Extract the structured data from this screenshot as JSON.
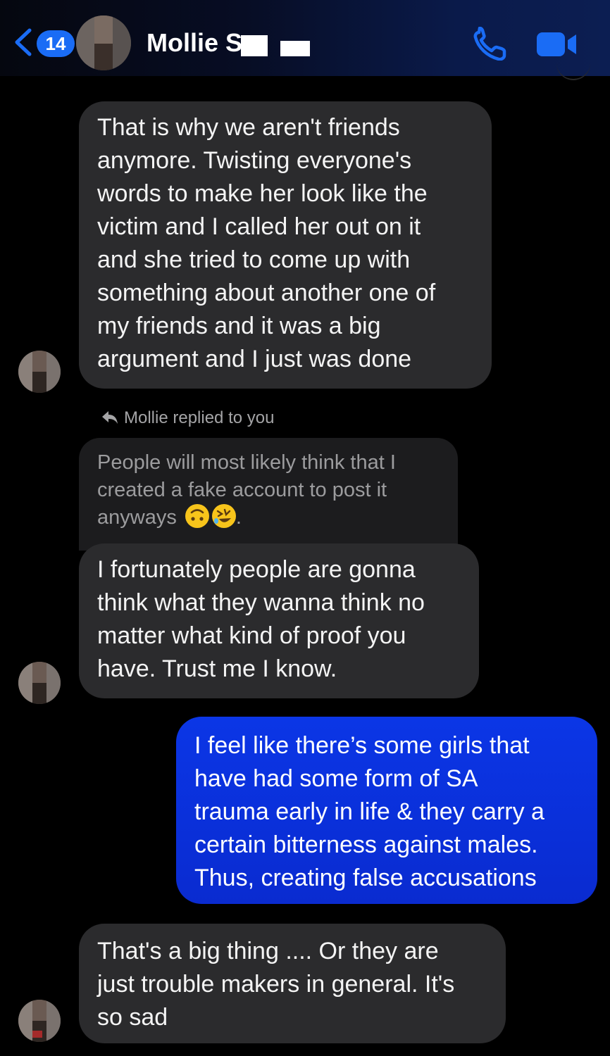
{
  "header": {
    "back_count": "14",
    "contact_name": "Mollie S",
    "icons": {
      "back": "chevron-left-icon",
      "call": "phone-icon",
      "video": "video-camera-icon"
    },
    "accent_color": "#1a6cf5"
  },
  "messages": [
    {
      "direction": "incoming",
      "text": "That is why we aren't friends\nanymore. Twisting everyone's\nwords to make her look like the\nvictim and I called her out on it\nand she tried to come up with\nsomething about another one of\nmy friends and it was a big\nargument and I just was done"
    },
    {
      "reply_label": "Mollie replied to you",
      "quoted_text": "People will most likely think that I\ncreated a fake account to post it\nanyways",
      "quoted_emojis": [
        "upside-down-face",
        "rolling-on-floor-laughing"
      ],
      "quoted_trailing": ".",
      "direction": "incoming",
      "text": "I fortunately people are gonna\nthink what they wanna think no\nmatter what kind of proof you\nhave. Trust me I know."
    },
    {
      "direction": "outgoing",
      "text": "I feel like there’s some girls that\nhave had some form of SA\ntrauma early in life & they carry a\ncertain bitterness against males.\nThus, creating false accusations"
    },
    {
      "direction": "incoming",
      "text": "That's a big thing .... Or they are\njust trouble makers in general. It's\nso sad"
    }
  ],
  "colors": {
    "incoming_bubble": "#2b2b2d",
    "outgoing_bubble": "#0b36e6",
    "background": "#000000"
  }
}
